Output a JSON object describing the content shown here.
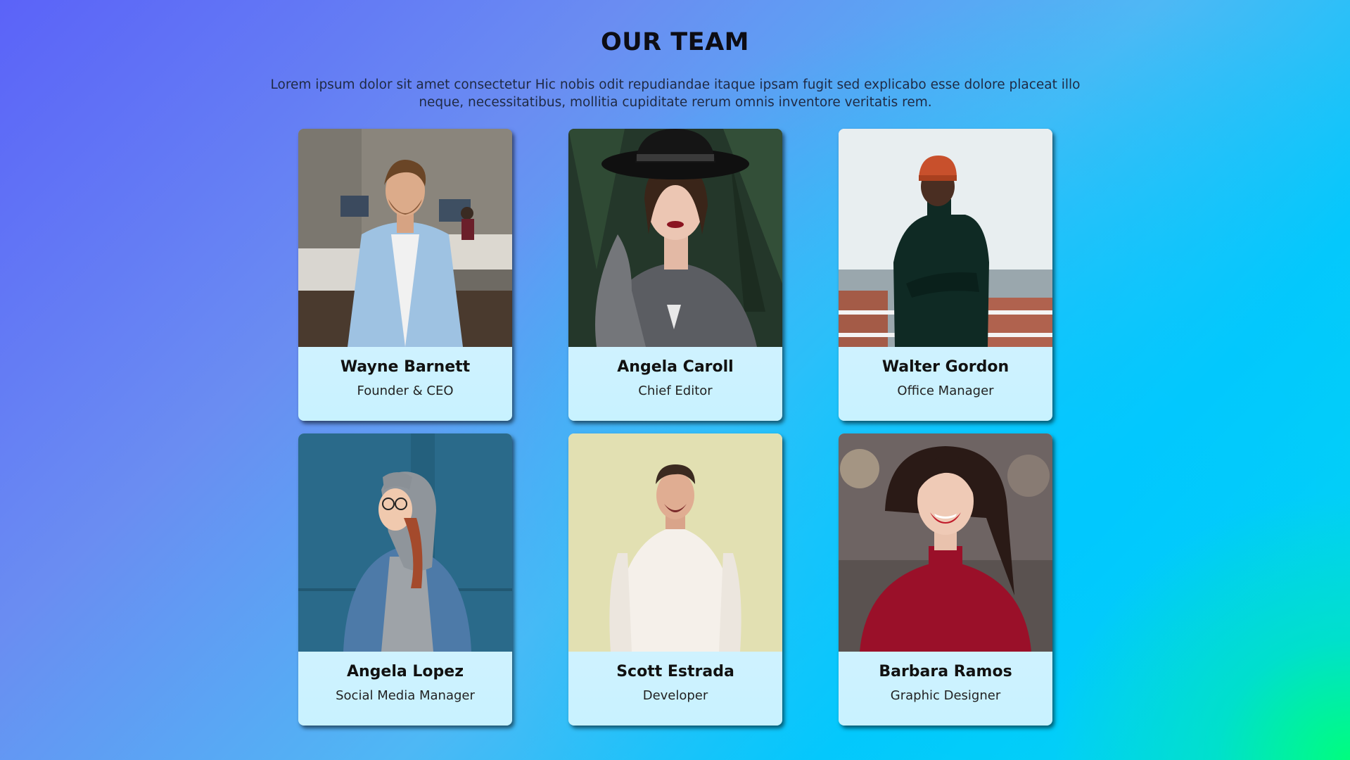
{
  "header": {
    "title": "OUR TEAM",
    "subtitle": "Lorem ipsum dolor sit amet consectetur Hic nobis odit repudiandae itaque ipsam fugit sed explicabo esse dolore placeat illo neque, necessitatibus, mollitia cupiditate rerum omnis inventore veritatis rem."
  },
  "team": [
    {
      "name": "Wayne Barnett",
      "role": "Founder & CEO",
      "photo": "man-in-office-photo"
    },
    {
      "name": "Angela Caroll",
      "role": "Chief Editor",
      "photo": "woman-with-hat-photo"
    },
    {
      "name": "Walter Gordon",
      "role": "Office Manager",
      "photo": "man-on-rooftop-photo"
    },
    {
      "name": "Angela Lopez",
      "role": "Social Media Manager",
      "photo": "woman-in-hoodie-photo"
    },
    {
      "name": "Scott Estrada",
      "role": "Developer",
      "photo": "man-in-sweater-photo"
    },
    {
      "name": "Barbara Ramos",
      "role": "Graphic Designer",
      "photo": "woman-in-red-top-photo"
    }
  ]
}
